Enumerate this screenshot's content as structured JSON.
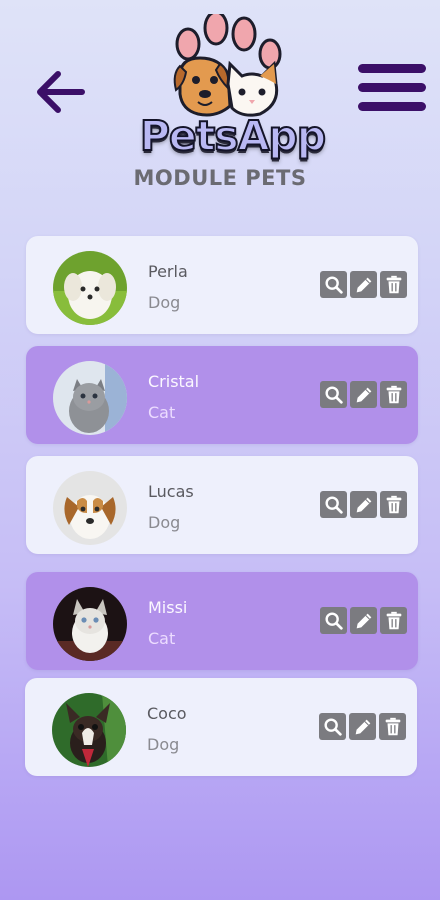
{
  "app": {
    "name": "PetsApp",
    "module_title": "MODULE PETS"
  },
  "nav": {
    "back_icon": "arrow-left-icon",
    "menu_icon": "hamburger-menu-icon"
  },
  "pets": [
    {
      "name": "Perla",
      "type": "Dog",
      "style": "light"
    },
    {
      "name": "Cristal",
      "type": "Cat",
      "style": "purple"
    },
    {
      "name": "Lucas",
      "type": "Dog",
      "style": "light"
    },
    {
      "name": "Missi",
      "type": "Cat",
      "style": "purple"
    },
    {
      "name": "Coco",
      "type": "Dog",
      "style": "light"
    }
  ],
  "actions": {
    "view_icon": "search-icon",
    "edit_icon": "pencil-icon",
    "delete_icon": "trash-icon"
  },
  "colors": {
    "accent": "#3b0f68",
    "card_light": "#eef0fc",
    "card_purple": "#b190ea",
    "action_button": "#7b7b80"
  }
}
